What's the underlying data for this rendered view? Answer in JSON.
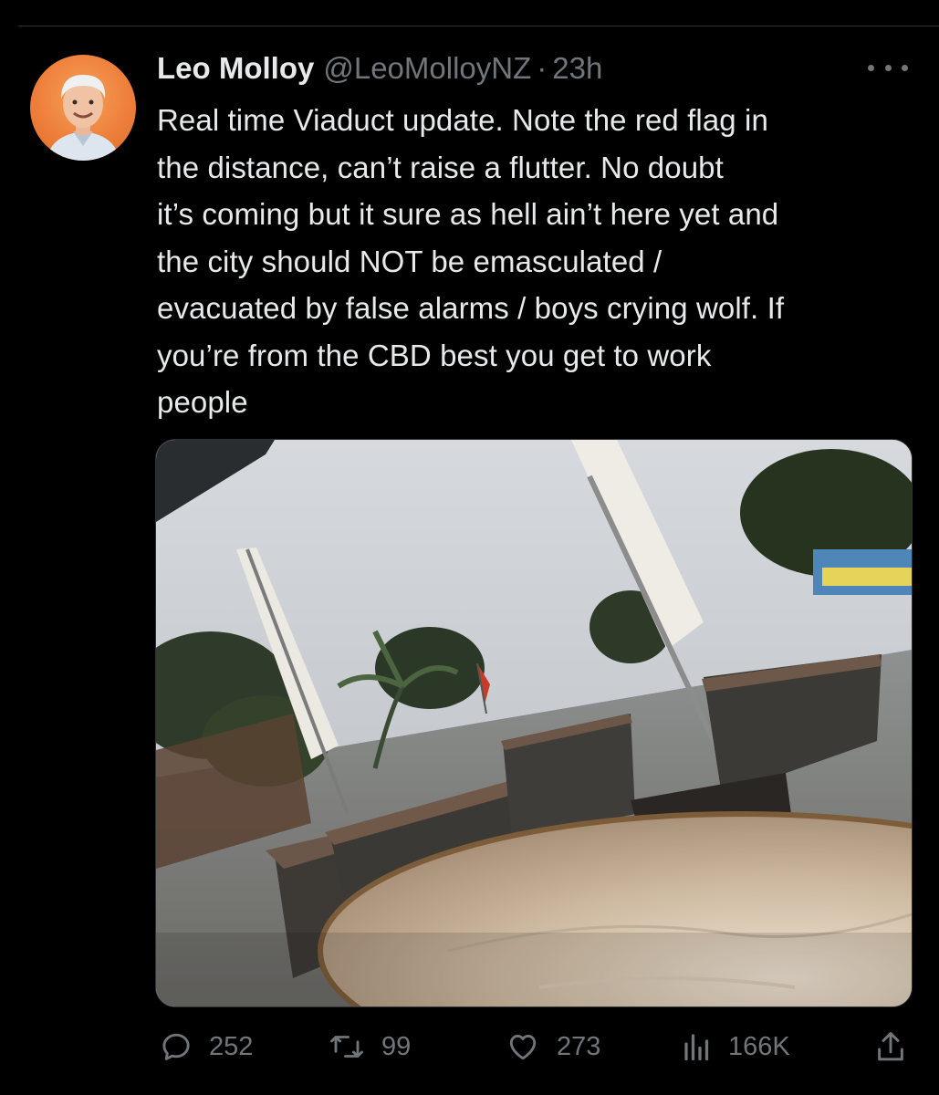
{
  "tweet": {
    "author_name": "Leo Molloy",
    "author_handle": "@LeoMolloyNZ",
    "separator": "·",
    "timestamp": "23h",
    "text_lines": [
      "Real time Viaduct update. Note the red flag in",
      "the distance, can’t raise a flutter. No doubt",
      "it’s coming but it sure as hell ain’t here yet and",
      "the city should NOT be emasculated /",
      "evacuated by false alarms / boys crying wolf. If",
      "you’re from the CBD best you get to work",
      "people"
    ]
  },
  "actions": {
    "reply": {
      "icon": "reply-icon",
      "count": "252"
    },
    "retweet": {
      "icon": "retweet-icon",
      "count": "99"
    },
    "like": {
      "icon": "heart-icon",
      "count": "273"
    },
    "views": {
      "icon": "views-icon",
      "count": "166K"
    },
    "share": {
      "icon": "share-icon"
    }
  },
  "colors": {
    "background": "#000000",
    "text_primary": "#e7e9ea",
    "text_secondary": "#71767b",
    "divider": "#2f3336"
  }
}
